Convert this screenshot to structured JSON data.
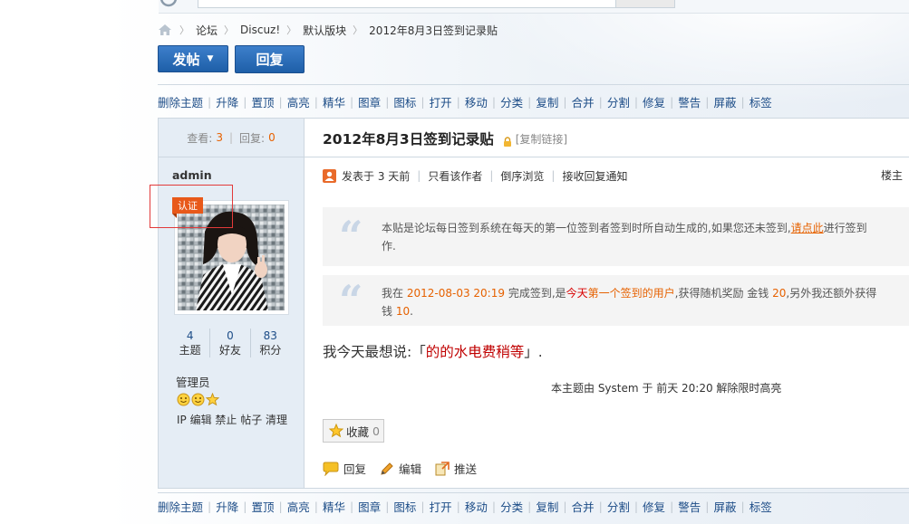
{
  "search": {
    "placeholder": ""
  },
  "breadcrumb": {
    "items": [
      "论坛",
      "Discuz!",
      "默认版块",
      "2012年8月3日签到记录贴"
    ]
  },
  "actions": {
    "post_label": "发帖",
    "reply_label": "回复"
  },
  "moderation": {
    "items": [
      "删除主题",
      "升降",
      "置顶",
      "高亮",
      "精华",
      "图章",
      "图标",
      "打开",
      "移动",
      "分类",
      "复制",
      "合并",
      "分割",
      "修复",
      "警告",
      "屏蔽",
      "标签"
    ]
  },
  "thread": {
    "views_label": "查看:",
    "views": "3",
    "replies_label": "回复:",
    "replies": "0",
    "title": "2012年8月3日签到记录贴",
    "copy_link": "[复制链接]"
  },
  "author": {
    "name": "admin",
    "badge": "认证",
    "stats": [
      {
        "value": "4",
        "label": "主题"
      },
      {
        "value": "0",
        "label": "好友"
      },
      {
        "value": "83",
        "label": "积分"
      }
    ],
    "role": "管理员",
    "tools": "IP 编辑 禁止 帖子 清理"
  },
  "post": {
    "posted_at": "发表于 3 天前",
    "only_author": "只看该作者",
    "reverse": "倒序浏览",
    "notify": "接收回复通知",
    "floor": "楼主",
    "quote1_a": "本贴是论坛每日签到系统在每天的第一位签到者签到时所自动生成的,如果您还未签到,",
    "quote1_link": "请点此",
    "quote1_b": "进行签到",
    "quote1_c": "作.",
    "quote2_a": "我在",
    "quote2_date": "2012-08-03 20:19",
    "quote2_b": "完成签到,是",
    "quote2_today": "今天",
    "quote2_first": "第一个签到的用户",
    "quote2_c": ",获得随机奖励 金钱",
    "quote2_money": "20",
    "quote2_d": ",另外我还额外获得",
    "quote2_e": "钱",
    "quote2_extra": "10",
    "quote2_f": ".",
    "mood_a": "我今天最想说:「",
    "mood_text": "的的水电费稍等",
    "mood_b": "」.",
    "highlight_note": "本主题由 System 于 前天 20:20 解除限时高亮",
    "fav_label": "收藏",
    "fav_count": "0",
    "reply_label": "回复",
    "edit_label": "编辑",
    "push_label": "推送"
  },
  "colors": {
    "accent": "#1e5fa8",
    "link": "#1c4c87",
    "highlight": "#e66100",
    "alert": "#d80000"
  }
}
